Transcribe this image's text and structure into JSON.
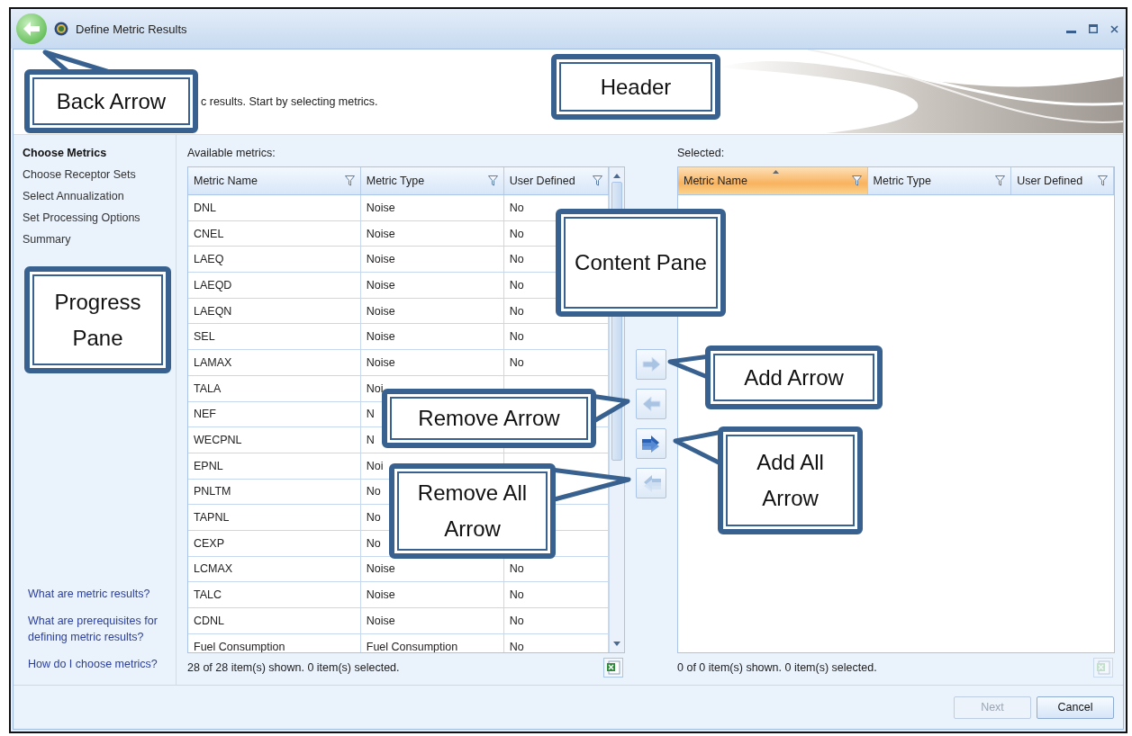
{
  "window": {
    "title": "Define Metric Results"
  },
  "header": {
    "description": "c results. Start by selecting metrics."
  },
  "progress_steps": [
    {
      "label": "Choose Metrics",
      "selected": true
    },
    {
      "label": "Choose Receptor Sets",
      "selected": false
    },
    {
      "label": "Select Annualization",
      "selected": false
    },
    {
      "label": "Set Processing Options",
      "selected": false
    },
    {
      "label": "Summary",
      "selected": false
    }
  ],
  "help_links": [
    "What are metric results?",
    "What are prerequisites for defining metric results?",
    "How do I choose metrics?"
  ],
  "available": {
    "label": "Available metrics:",
    "columns": [
      {
        "label": "Metric Name",
        "selected": false
      },
      {
        "label": "Metric Type",
        "selected": false
      },
      {
        "label": "User Defined",
        "selected": false
      }
    ],
    "rows": [
      {
        "name": "DNL",
        "type": "Noise",
        "user_defined": "No"
      },
      {
        "name": "CNEL",
        "type": "Noise",
        "user_defined": "No"
      },
      {
        "name": "LAEQ",
        "type": "Noise",
        "user_defined": "No"
      },
      {
        "name": "LAEQD",
        "type": "Noise",
        "user_defined": "No"
      },
      {
        "name": "LAEQN",
        "type": "Noise",
        "user_defined": "No"
      },
      {
        "name": "SEL",
        "type": "Noise",
        "user_defined": "No"
      },
      {
        "name": "LAMAX",
        "type": "Noise",
        "user_defined": "No"
      },
      {
        "name": "TALA",
        "type": "Noi"
      },
      {
        "name": "NEF",
        "type": "N"
      },
      {
        "name": "WECPNL",
        "type": "N"
      },
      {
        "name": "EPNL",
        "type": "Noi"
      },
      {
        "name": "PNLTM",
        "type": "No"
      },
      {
        "name": "TAPNL",
        "type": "No"
      },
      {
        "name": "CEXP",
        "type": "No"
      },
      {
        "name": "LCMAX",
        "type": "Noise",
        "user_defined": "No"
      },
      {
        "name": "TALC",
        "type": "Noise",
        "user_defined": "No"
      },
      {
        "name": "CDNL",
        "type": "Noise",
        "user_defined": "No"
      },
      {
        "name": "Fuel Consumption",
        "type": "Fuel Consumption",
        "user_defined": "No"
      }
    ],
    "status": "28 of 28 item(s) shown. 0 item(s) selected.",
    "export_disabled": false
  },
  "transfer_buttons": [
    {
      "kind": "add",
      "disabled": true
    },
    {
      "kind": "remove",
      "disabled": true
    },
    {
      "kind": "add_all",
      "disabled": false
    },
    {
      "kind": "remove_all",
      "disabled": true
    }
  ],
  "selected": {
    "label": "Selected:",
    "columns": [
      {
        "label": "Metric Name",
        "selected": true
      },
      {
        "label": "Metric Type",
        "selected": false
      },
      {
        "label": "User Defined",
        "selected": false
      }
    ],
    "status": "0 of 0 item(s) shown. 0 item(s) selected.",
    "export_disabled": true
  },
  "buttons": [
    {
      "label": "Next",
      "disabled": true
    },
    {
      "label": "Cancel",
      "disabled": false
    }
  ],
  "annotations": [
    "Back Arrow",
    "Header",
    "Content Pane",
    "Progress Pane",
    "Add Arrow",
    "Remove Arrow",
    "Add All Arrow",
    "Remove All Arrow"
  ]
}
